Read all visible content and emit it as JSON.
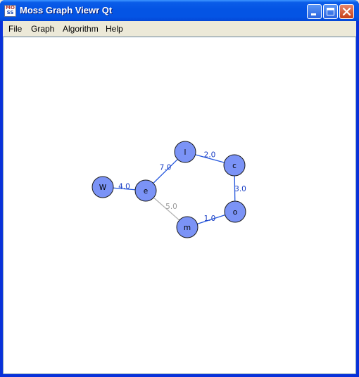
{
  "window": {
    "title": "Moss Graph Viewr Qt",
    "icon_text_top": "MO",
    "icon_text_bottom": "SS"
  },
  "menu": [
    {
      "label": "File"
    },
    {
      "label": "Graph"
    },
    {
      "label": "Algorithm"
    },
    {
      "label": "Help"
    }
  ],
  "colors": {
    "node_fill": "#7b93f6",
    "edge_active": "#2255dd",
    "edge_inactive": "#b0b0b0",
    "label_active": "#1a3fc4",
    "label_inactive": "#9a9a9a"
  },
  "graph": {
    "nodes": [
      {
        "id": "W",
        "label": "W"
      },
      {
        "id": "e",
        "label": "e"
      },
      {
        "id": "l",
        "label": "l"
      },
      {
        "id": "c",
        "label": "c"
      },
      {
        "id": "o",
        "label": "o"
      },
      {
        "id": "m",
        "label": "m"
      }
    ],
    "edges": [
      {
        "from": "W",
        "to": "e",
        "weight": "4.0",
        "active": true
      },
      {
        "from": "e",
        "to": "l",
        "weight": "7.0",
        "active": true
      },
      {
        "from": "l",
        "to": "c",
        "weight": "2.0",
        "active": true
      },
      {
        "from": "c",
        "to": "o",
        "weight": "3.0",
        "active": true
      },
      {
        "from": "o",
        "to": "m",
        "weight": "1.0",
        "active": true
      },
      {
        "from": "e",
        "to": "m",
        "weight": "5.0",
        "active": false
      }
    ]
  }
}
